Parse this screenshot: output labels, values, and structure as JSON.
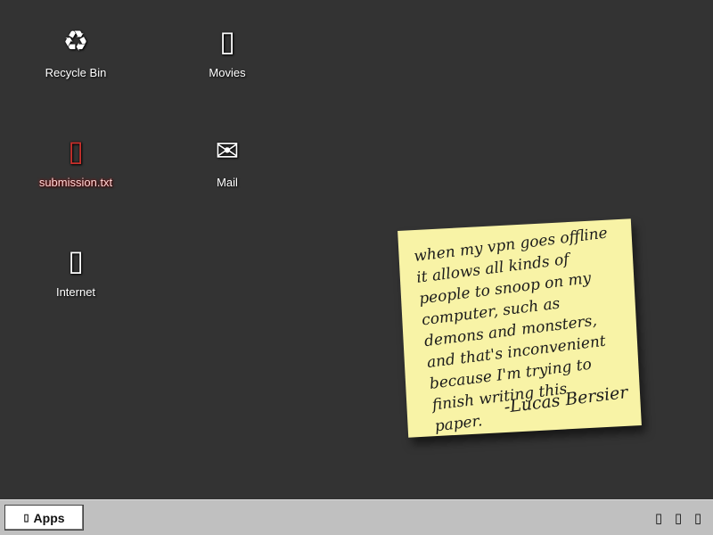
{
  "desktop": {
    "icons": [
      {
        "label": "Recycle Bin",
        "icon": "recycle-bin-icon",
        "glyph": "♻"
      },
      {
        "label": "Movies",
        "icon": "movies-folder-icon",
        "glyph": "▯"
      },
      {
        "label": "submission.txt",
        "icon": "text-file-icon",
        "glyph": "▯",
        "selected": true
      },
      {
        "label": "Mail",
        "icon": "mail-icon",
        "glyph": "✉"
      },
      {
        "label": "Internet",
        "icon": "internet-icon",
        "glyph": "▯"
      }
    ]
  },
  "sticky_note": {
    "text": "when my vpn goes offline\nit allows all kinds of\npeople to snoop on my\ncomputer, such as\ndemons and monsters,\nand that's inconvenient\nbecause I'm trying to\nfinish writing this\npaper.",
    "signature": "-Lucas Bersier",
    "color": "#f8f3a6"
  },
  "taskbar": {
    "apps_label": "Apps",
    "apps_glyph": "▯",
    "tray_icons": [
      {
        "icon": "tray-icon-1",
        "glyph": "▯"
      },
      {
        "icon": "tray-icon-2",
        "glyph": "▯"
      },
      {
        "icon": "tray-icon-3",
        "glyph": "▯"
      }
    ]
  },
  "colors": {
    "desktop_bg": "#333333",
    "taskbar_bg": "#c0c0c0",
    "selected_accent": "#c9302c"
  }
}
